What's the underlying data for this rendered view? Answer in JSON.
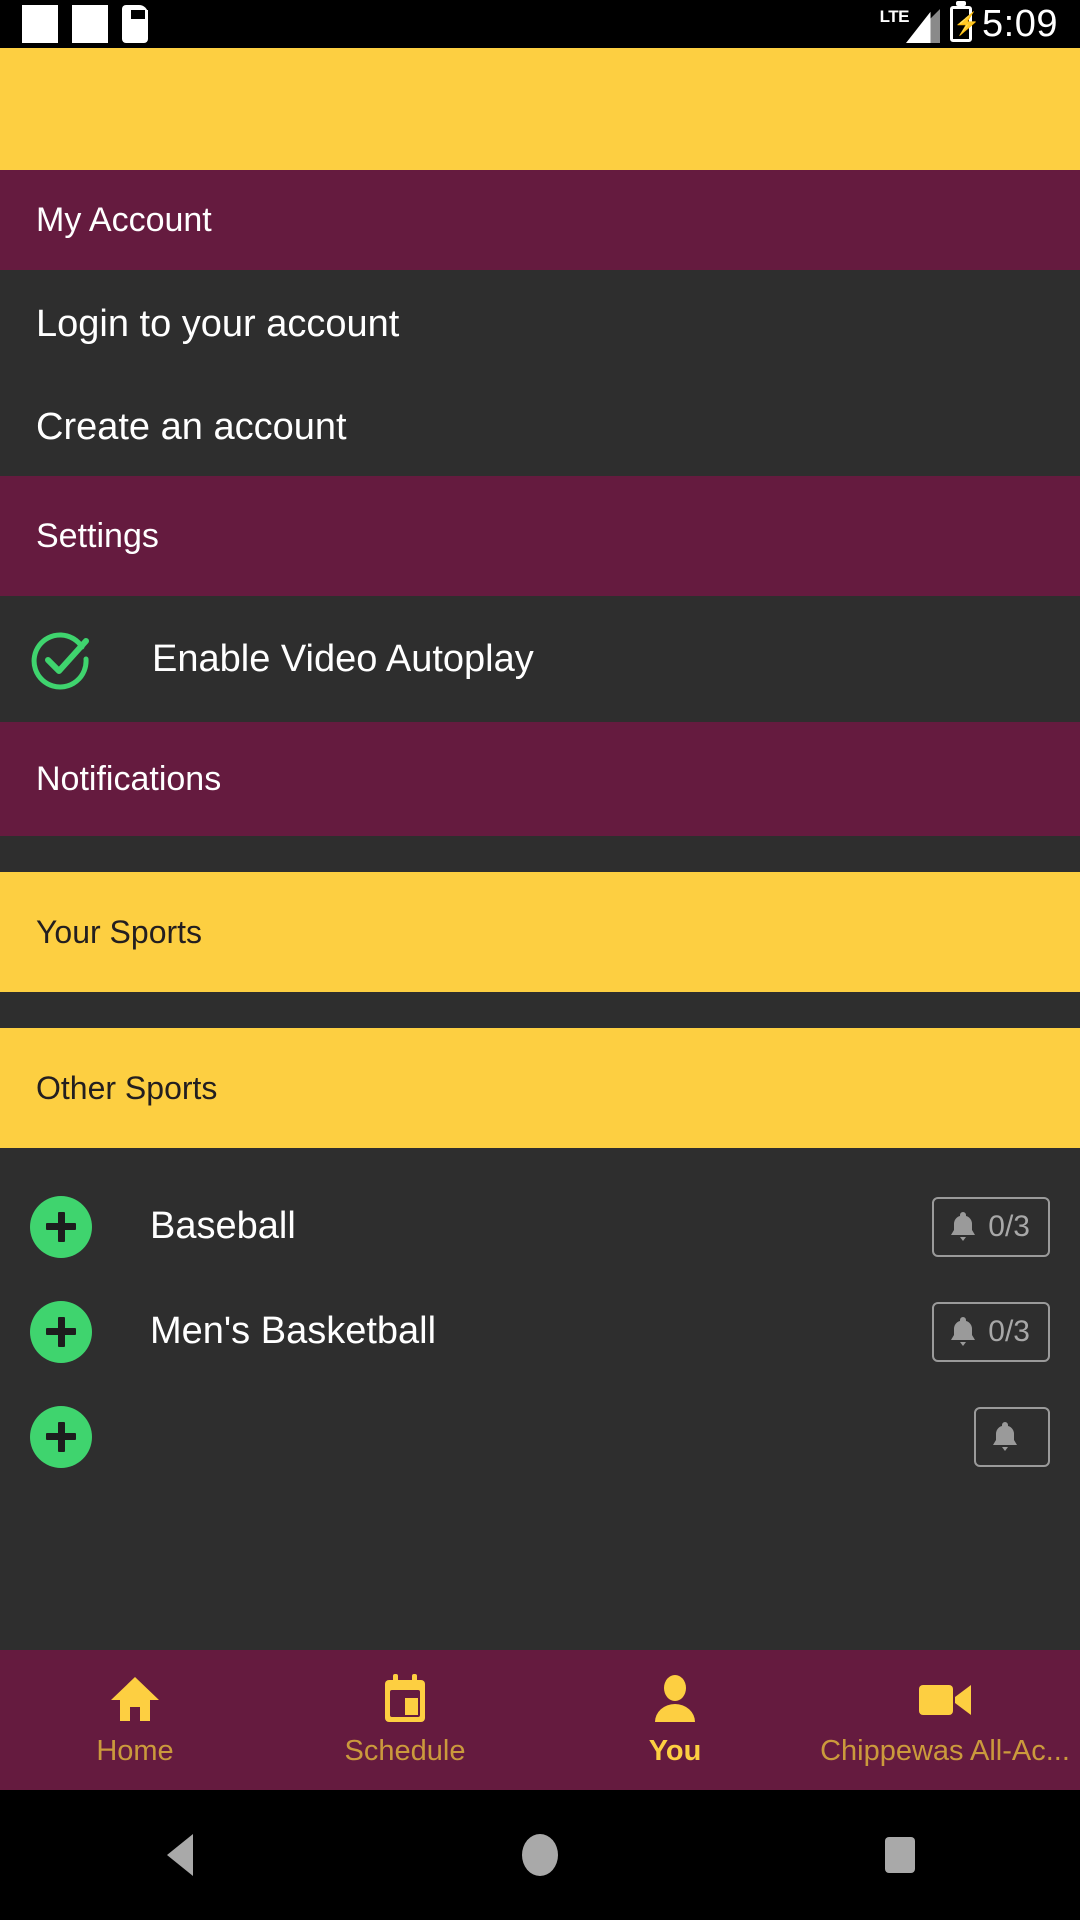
{
  "status_bar": {
    "icons": [
      "white-square-icon",
      "white-square-icon",
      "sd-card-icon"
    ],
    "network": "LTE",
    "battery": "charging",
    "time": "5:09"
  },
  "colors": {
    "yellow": "#fdcf41",
    "maroon": "#651b3f",
    "dark": "#2e2e2e",
    "green": "#3fd46e",
    "gray": "#9a9a9a"
  },
  "sections": {
    "my_account": {
      "title": "My Account",
      "items": [
        {
          "label": "Login to your account"
        },
        {
          "label": "Create an account"
        }
      ]
    },
    "settings": {
      "title": "Settings",
      "toggle": {
        "label": "Enable Video Autoplay",
        "state": "enabled",
        "icon": "check-circle-icon"
      }
    },
    "notifications": {
      "title": "Notifications"
    },
    "your_sports": {
      "title": "Your Sports",
      "items": []
    },
    "other_sports": {
      "title": "Other Sports",
      "items": [
        {
          "name": "Baseball",
          "add_icon": "plus-circle-icon",
          "notif_icon": "bell-icon",
          "notif_count": "0/3"
        },
        {
          "name": "Men's Basketball",
          "add_icon": "plus-circle-icon",
          "notif_icon": "bell-icon",
          "notif_count": "0/3"
        },
        {
          "name": "",
          "add_icon": "plus-circle-icon",
          "notif_icon": "bell-icon",
          "notif_count": ""
        }
      ]
    }
  },
  "tab_bar": {
    "tabs": [
      {
        "label": "Home",
        "icon": "home-icon",
        "active": false
      },
      {
        "label": "Schedule",
        "icon": "calendar-icon",
        "active": false
      },
      {
        "label": "You",
        "icon": "person-icon",
        "active": true
      },
      {
        "label": "Chippewas All-Ac...",
        "icon": "video-camera-icon",
        "active": false
      }
    ]
  },
  "android_nav": {
    "back": "back-triangle-icon",
    "home": "home-circle-icon",
    "recents": "recents-square-icon"
  }
}
